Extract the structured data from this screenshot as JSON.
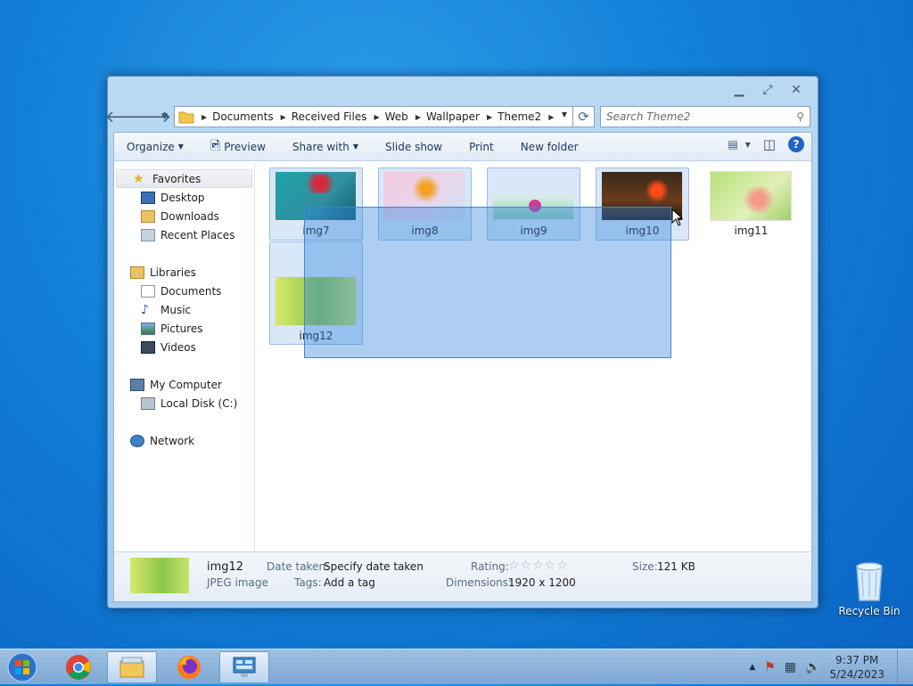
{
  "desktop": {
    "recycle_bin_label": "Recycle Bin"
  },
  "window": {
    "breadcrumb": [
      "Documents",
      "Received Files",
      "Web",
      "Wallpaper",
      "Theme2"
    ],
    "search_placeholder": "Search Theme2",
    "toolbar": {
      "organize": "Organize",
      "preview": "Preview",
      "share_with": "Share with",
      "slide_show": "Slide show",
      "print": "Print",
      "new_folder": "New folder",
      "help": "?"
    },
    "sidebar": {
      "favorites": "Favorites",
      "desktop": "Desktop",
      "downloads": "Downloads",
      "recent_places": "Recent Places",
      "libraries": "Libraries",
      "documents": "Documents",
      "music": "Music",
      "pictures": "Pictures",
      "videos": "Videos",
      "my_computer": "My Computer",
      "local_disk": "Local Disk (C:)",
      "network": "Network"
    },
    "files": [
      {
        "name": "img7",
        "selected": true
      },
      {
        "name": "img8",
        "selected": true
      },
      {
        "name": "img9",
        "selected": true
      },
      {
        "name": "img10",
        "selected": true
      },
      {
        "name": "img11",
        "selected": false
      },
      {
        "name": "img12",
        "selected": true
      }
    ],
    "details": {
      "name": "img12",
      "type": "JPEG image",
      "date_taken_label": "Date taken:",
      "date_taken_value": "Specify date taken",
      "tags_label": "Tags:",
      "tags_value": "Add a tag",
      "rating_label": "Rating:",
      "rating_stars": "☆☆☆☆☆",
      "dimensions_label": "Dimensions:",
      "dimensions_value": "1920 x 1200",
      "size_label": "Size:",
      "size_value": "121 KB"
    }
  },
  "taskbar": {
    "time": "9:37 PM",
    "date": "5/24/2023"
  },
  "colors": {
    "selection": "#3384dc",
    "desktop": "#127fd8",
    "accent": "#1f64c4"
  }
}
